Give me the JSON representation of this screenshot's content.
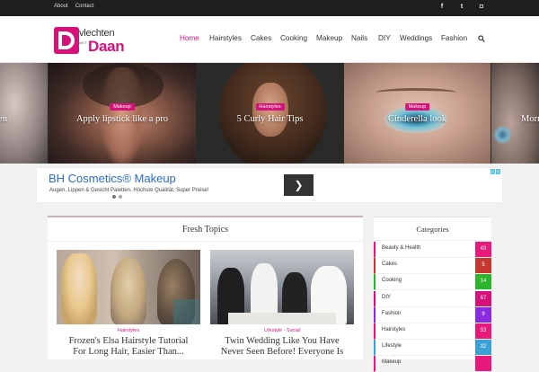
{
  "topbar": {
    "links": [
      "About",
      "Contact"
    ],
    "social": [
      {
        "icon": "facebook-icon",
        "glyph": "f"
      },
      {
        "icon": "twitter-icon",
        "glyph": "t"
      },
      {
        "icon": "instagram-icon",
        "glyph": "◘"
      }
    ]
  },
  "logo": {
    "line1": "vlechten",
    "line2": "Daan",
    "small": "MET"
  },
  "nav": {
    "items": [
      "Home",
      "Hairstyles",
      "Cakes",
      "Cooking",
      "Makeup",
      "Nails",
      "DIY",
      "Weddings",
      "Fashion"
    ],
    "active": "Home",
    "search_icon": "search-icon"
  },
  "slider": {
    "slides": [
      {
        "tag": "",
        "title": "en"
      },
      {
        "tag": "Makeup",
        "title": "Apply lipstick like a pro"
      },
      {
        "tag": "Hairstyles",
        "title": "5 Curly Hair Tips"
      },
      {
        "tag": "Makeup",
        "title": "Cinderella look"
      },
      {
        "tag": "",
        "title": "Morn"
      }
    ]
  },
  "ad": {
    "title": "BH Cosmetics® Makeup",
    "subtitle": "Augen, Lippen & Gesicht Paletten. Höchste Qualität, Super Preise!",
    "arrow_glyph": "❯"
  },
  "fresh": {
    "heading": "Fresh Topics",
    "cards": [
      {
        "tags": [
          "Hairstyles"
        ],
        "title_line1": "Frozen's Elsa Hairstyle Tutorial",
        "title_line2": "For Long Hair, Easier Than..."
      },
      {
        "tags": [
          "Lifestyle",
          "Social"
        ],
        "separator": " - ",
        "title_line1": "Twin Wedding Like You Have",
        "title_line2": "Never Seen Before! Everyone Is"
      }
    ]
  },
  "categories": {
    "heading": "Categories",
    "items": [
      {
        "label": "Beauty & Health",
        "count": "43",
        "color": "#e8197a"
      },
      {
        "label": "Cakes",
        "count": "5",
        "color": "#c8372d"
      },
      {
        "label": "Cooking",
        "count": "14",
        "color": "#2db52d"
      },
      {
        "label": "DIY",
        "count": "67",
        "color": "#d6127a"
      },
      {
        "label": "Fashion",
        "count": "9",
        "color": "#8a2be2"
      },
      {
        "label": "Hairstyles",
        "count": "53",
        "color": "#e8197a"
      },
      {
        "label": "Lifestyle",
        "count": "32",
        "color": "#3aa0d8"
      },
      {
        "label": "Makeup",
        "count": "",
        "color": "#e8197a"
      }
    ]
  },
  "colors": {
    "accent": "#d6127a",
    "ad_blue": "#2a6ad2"
  }
}
